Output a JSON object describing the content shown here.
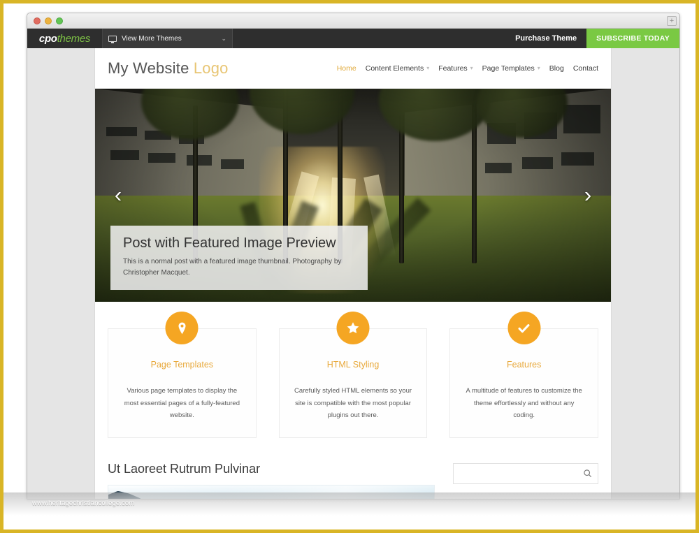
{
  "browser": {
    "traffic_lights": [
      "close",
      "minimize",
      "zoom"
    ],
    "resize_grip": "+"
  },
  "admin_bar": {
    "logo_main": "cpo",
    "logo_accent": "themes",
    "theme_switcher": {
      "icon": "monitor-icon",
      "label": "View More Themes",
      "caret": "⌄"
    },
    "purchase_label": "Purchase Theme",
    "subscribe_label": "SUBSCRIBE TODAY",
    "subscribe_color": "#7ac943",
    "bar_color": "#2e2e2e"
  },
  "site": {
    "logo_main": "My Website",
    "logo_accent": "Logo",
    "accent_color": "#e0a93a",
    "nav": [
      {
        "label": "Home",
        "has_caret": false,
        "active": true
      },
      {
        "label": "Content Elements",
        "has_caret": true,
        "active": false
      },
      {
        "label": "Features",
        "has_caret": true,
        "active": false
      },
      {
        "label": "Page Templates",
        "has_caret": true,
        "active": false
      },
      {
        "label": "Blog",
        "has_caret": false,
        "active": false
      },
      {
        "label": "Contact",
        "has_caret": false,
        "active": false
      }
    ]
  },
  "hero": {
    "prev_arrow": "‹",
    "next_arrow": "›",
    "caption_title": "Post with Featured Image Preview",
    "caption_text": "This is a normal post with a featured image thumbnail. Photography by Christopher Macquet."
  },
  "features": [
    {
      "icon": "map-pin-icon",
      "title": "Page Templates",
      "text": "Various page templates to display the most essential pages of a fully-featured website."
    },
    {
      "icon": "star-icon",
      "title": "HTML Styling",
      "text": "Carefully styled HTML elements so your site is compatible with the most popular plugins out there."
    },
    {
      "icon": "check-circle-icon",
      "title": "Features",
      "text": "A multitude of features to customize the theme effortlessly and without any coding."
    }
  ],
  "lower": {
    "post_title": "Ut Laoreet Rutrum Pulvinar",
    "search": {
      "value": "",
      "placeholder": "",
      "icon": "search-icon"
    }
  },
  "watermark": "www.heritagechristiancollege.com",
  "frame_color": "#d9b526"
}
